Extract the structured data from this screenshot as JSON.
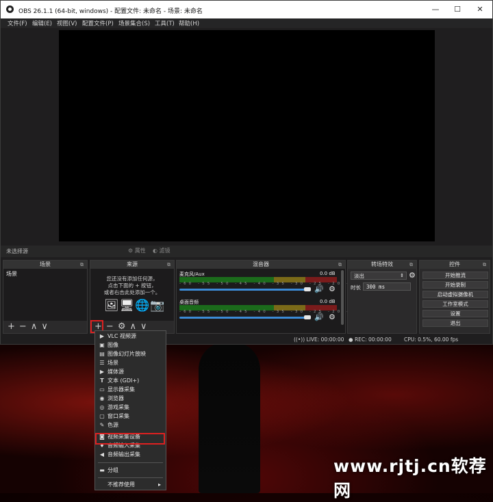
{
  "window": {
    "title": "OBS 26.1.1 (64-bit, windows) - 配置文件: 未命名 - 场景: 未命名",
    "controls": [
      "—",
      "☐",
      "✕"
    ]
  },
  "menubar": [
    "文件(F)",
    "编辑(E)",
    "视图(V)",
    "配置文件(P)",
    "场景集合(S)",
    "工具(T)",
    "帮助(H)"
  ],
  "status_strip": {
    "no_source": "未选择源",
    "properties": "属性",
    "filters": "滤镜"
  },
  "docks": {
    "scenes": {
      "title": "场景",
      "items": [
        "场景"
      ]
    },
    "sources": {
      "title": "来源",
      "empty_text": [
        "您还没有添加任何源，",
        "点击下面的 + 按钮，",
        "或者右击此处添加一个。"
      ]
    },
    "mixer": {
      "title": "混音器",
      "channels": [
        {
          "name": "麦克风/Aux",
          "db": "0.0 dB"
        },
        {
          "name": "桌面音频",
          "db": "0.0 dB"
        }
      ],
      "scale": "-60 -55 -50 -45 -40 -35 -30 -25 -20 -15 -10 -5 0"
    },
    "transitions": {
      "title": "转场特效",
      "selected": "淡出",
      "duration_label": "时长",
      "duration_value": "300 ms"
    },
    "controls": {
      "title": "控件",
      "buttons": [
        "开始推流",
        "开始录制",
        "启动虚拟摄像机",
        "工作室模式",
        "设置",
        "退出"
      ]
    }
  },
  "bottombar": {
    "live": "LIVE: 00:00:00",
    "rec": "REC: 00:00:00",
    "cpu": "CPU: 0.5%, 60.00 fps"
  },
  "context_menu": {
    "items": [
      {
        "icon": "▶",
        "label": "VLC 视频源"
      },
      {
        "icon": "▣",
        "label": "图像"
      },
      {
        "icon": "▤",
        "label": "图像幻灯片放映"
      },
      {
        "icon": "☰",
        "label": "场景"
      },
      {
        "icon": "▶",
        "label": "媒体源"
      },
      {
        "icon": "T",
        "label": "文本 (GDI+)"
      },
      {
        "icon": "▭",
        "label": "显示器采集"
      },
      {
        "icon": "◉",
        "label": "浏览器"
      },
      {
        "icon": "◎",
        "label": "游戏采集"
      },
      {
        "icon": "▢",
        "label": "窗口采集"
      },
      {
        "icon": "✎",
        "label": "色源"
      },
      {
        "icon": "◙",
        "label": "视频采集设备"
      },
      {
        "icon": "♦",
        "label": "音频输入采集"
      },
      {
        "icon": "◀",
        "label": "音频输出采集"
      }
    ],
    "group": "分组",
    "deprecated": "不推荐使用"
  },
  "watermark": "www.rjtj.cn软荐网"
}
